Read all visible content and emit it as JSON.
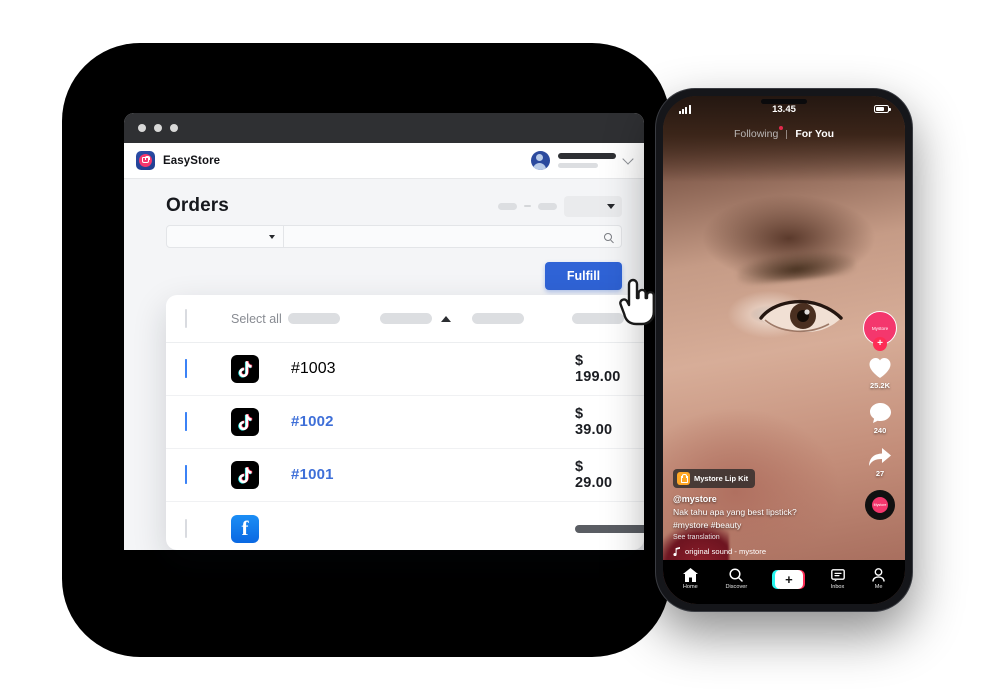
{
  "backdrop": {
    "color": "#000000"
  },
  "desktop": {
    "titlebar": {
      "dots": 3
    },
    "appbar": {
      "brand": "EasyStore",
      "logo_icon": "easystore-bag-logo",
      "avatar_icon": "user-avatar-icon",
      "chevron_icon": "chevron-down-icon"
    },
    "page": {
      "title": "Orders",
      "header_select_placeholder": "",
      "filter_select_value": "",
      "search_value": "",
      "search_icon": "search-icon",
      "fulfill_label": "Fulfill",
      "accent_blue": "#2f63d6"
    },
    "table": {
      "select_all_label": "Select all",
      "columns": [
        "",
        "",
        "",
        "",
        ""
      ],
      "sort_icon": "sort-ascending-icon",
      "rows": [
        {
          "checked": true,
          "channel": "tiktok",
          "order": "#1003",
          "amount": "$ 199.00"
        },
        {
          "checked": true,
          "channel": "tiktok",
          "order": "#1002",
          "amount": "$ 39.00"
        },
        {
          "checked": true,
          "channel": "tiktok",
          "order": "#1001",
          "amount": "$ 29.00"
        },
        {
          "checked": false,
          "channel": "facebook",
          "order": "",
          "amount": ""
        }
      ]
    },
    "cursor_icon": "pointing-hand-cursor"
  },
  "phone": {
    "status": {
      "time": "13.45",
      "signal_icon": "signal-bars-icon",
      "battery_icon": "battery-icon"
    },
    "feed_tabs": {
      "following": "Following",
      "for_you": "For You",
      "active": "For You"
    },
    "rail": {
      "avatar_label": "Mystore",
      "follow_icon": "plus-follow-icon",
      "like_icon": "heart-icon",
      "like_count": "25.2K",
      "comment_icon": "comment-bubble-icon",
      "comment_count": "240",
      "share_icon": "share-arrow-icon",
      "share_count": "27",
      "music_disc_icon": "music-disc-icon",
      "disc_label": "Mystore"
    },
    "caption": {
      "product_tag": "Mystore Lip Kit",
      "product_icon": "shopping-bag-icon",
      "username": "@mystore",
      "text": "Nak tahu apa yang best lipstick?",
      "hashtags": "#mystore #beauty",
      "translate": "See translation",
      "sound_icon": "music-note-icon",
      "sound": "original sound - mystore"
    },
    "nav": [
      {
        "label": "Home",
        "icon": "home-icon"
      },
      {
        "label": "Discover",
        "icon": "search-icon"
      },
      {
        "label": "+",
        "icon": "create-plus-icon"
      },
      {
        "label": "Inbox",
        "icon": "inbox-icon"
      },
      {
        "label": "Me",
        "icon": "person-icon"
      }
    ]
  }
}
